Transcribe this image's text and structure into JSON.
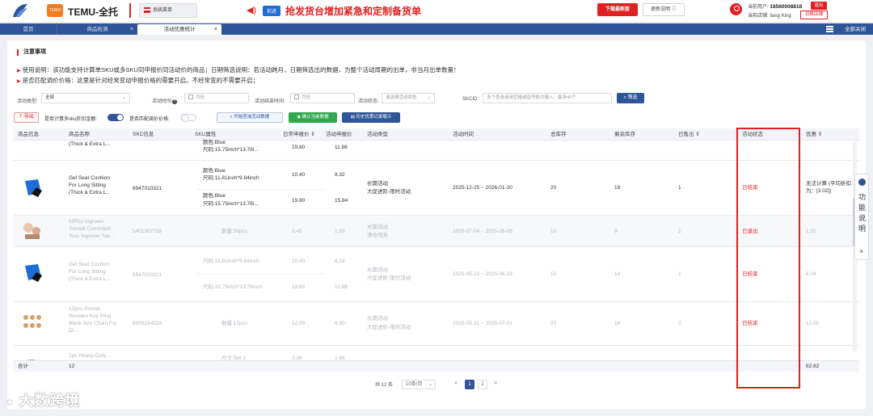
{
  "header": {
    "app_title": "TEMU-全托",
    "temu_badge": "TEMU",
    "system_menu": "系统菜单",
    "announcement_tag": "前进",
    "announcement": "抢发货台增加紧急和定制备货单",
    "download_label": "下载最新版",
    "update_label": "更新说明 ⓘ",
    "user_label": "当前用户:",
    "user_phone": "18560008818",
    "store_label": "当前店铺:",
    "store_name": "liang King",
    "logout_label": "退出",
    "switch_store_label": "切换店铺"
  },
  "tabs": [
    {
      "label": "首页"
    },
    {
      "label": "商品检测",
      "close": "×"
    },
    {
      "label": "活动优惠统计",
      "close": "×"
    }
  ],
  "close_all_label": "全部关闭",
  "notice": {
    "title": "注意事项",
    "line1": "使用说明：该功能支持计算单SKU或多SKU同申报价同活动价的商品；日期筛选说明：若活动跨月，日期筛选出的数据，为整个活动周期的出单，非当月出单数量！",
    "line2": "是否匹配调价价格：这里是针对经常变动申报价格的需要开启。不经常变的不需要开启；"
  },
  "filters": {
    "activity_type_label": "活动类型:",
    "activity_type_value": "全部",
    "activity_time_label": "活动时间",
    "activity_time_placeholder": "月份",
    "activity_end_label": "活动结束时间:",
    "activity_end_placeholder": "月份",
    "activity_status_label": "活动状态:",
    "activity_status_placeholder": "请选择活动状态",
    "skcid_label": "SKCID:",
    "skcid_placeholder": "多个查询请用空格或逗号依次输入，最多40个",
    "filter_button": "筛选"
  },
  "toolbar": {
    "export_label": "导出",
    "multi_sku_label": "是否计算多sku折扣金额:",
    "match_price_label": "是否匹配调价价格:",
    "query_button": "开始查询活动数据",
    "confirm_button": "确认当前数据",
    "history_button": "历史优惠记录展示"
  },
  "table": {
    "columns": [
      "商品信息",
      "商品名称",
      "SKC信息",
      "SKU属性",
      "日常申报价 ⇕",
      "活动申报价",
      "活动类型",
      "活动时间",
      "总库存",
      "剩余库存",
      "已售出 ⇕",
      "活动状态",
      "优惠 ⇕"
    ],
    "rows": [
      {
        "name": "(Thick & Extra L...",
        "skc": "",
        "sku_lines": [
          "颜色:Blue",
          "尺码:15.75inch*13.78i..."
        ],
        "daily": "19.80",
        "act": "11.86"
      },
      {
        "name": "Gel Seat Cushion For Long Sitting (Thick & Extra L...",
        "skc": "6947010321",
        "sku_a": [
          "颜色:Blue",
          "尺码:11.81inch*9.84inch"
        ],
        "sku_b": [
          "颜色:Blue",
          "尺码:15.75inch*13.78i..."
        ],
        "daily_a": "10.40",
        "act_a": "8.32",
        "daily_b": "19.80",
        "act_b": "15.84",
        "type": [
          "长期活动",
          "大促进阶-限时活动"
        ],
        "time": "2025-12-25 ~ 2026-01-20",
        "stock": "20",
        "remain": "19",
        "sold": "1",
        "status": "已结束",
        "discount": "无法计算 (平均折扣为：[3.02])"
      },
      {
        "name": "50Pcs Ingrown Toenail Correction Tool, Ingrown Toe...",
        "skc": "5401307728",
        "sku": "数量:50pcs",
        "daily": "3.45",
        "act": "1.93",
        "type": [
          "长期活动",
          "清仓甩卖"
        ],
        "time": "2025-07-04 ~ 2025-08-06",
        "stock": "10",
        "remain": "9",
        "sold": "1",
        "status": "已退出",
        "discount": "1.52"
      },
      {
        "name": "Gel Seat Cushion For Long Sitting (Thick & Extra L...",
        "skc": "6947010321",
        "sku_a": "尺码:11.81inch*9.84inch",
        "sku_b": "尺码:15.75inch*13.78inch",
        "daily_a": "10.40",
        "act_a": "6.24",
        "daily_b": "19.80",
        "act_b": "11.88",
        "type": [
          "长期活动",
          "大促进阶-限时活动"
        ],
        "time": "2025-05-23 ~ 2025-06-23",
        "stock": "15",
        "remain": "14",
        "sold": "1",
        "status": "已结束",
        "discount": "6.04"
      },
      {
        "name": "12pcs Round Wooden Key Ring Blank Key Chain For DI...",
        "skc": "8309154324",
        "sku": "数量:12pcs",
        "daily": "12.00",
        "act": "6.00",
        "type": [
          "长期活动",
          "大促进阶-限时活动"
        ],
        "time": "2025-05-31 ~ 2025-07-01",
        "stock": "20",
        "remain": "18",
        "sold": "2",
        "status": "已结束",
        "discount": "12.00"
      },
      {
        "name": "1pc Heavy-Duty...",
        "sku": "尺寸:Set 1",
        "daily": "3.36",
        "act": "1.68"
      }
    ],
    "summary_label": "合计",
    "summary_count": "12",
    "summary_discount": "62.62"
  },
  "pagination": {
    "total": "共 12 条",
    "per_page": "10条/页",
    "prev": "<",
    "page1": "1",
    "page2": "2",
    "next": ">"
  },
  "side_panel": {
    "label": "功能说明",
    "close": "×"
  },
  "watermark": "大数跨境",
  "colors": {
    "accent": "#2f5497",
    "brand_red": "#e02020",
    "success": "#2fa94f"
  }
}
